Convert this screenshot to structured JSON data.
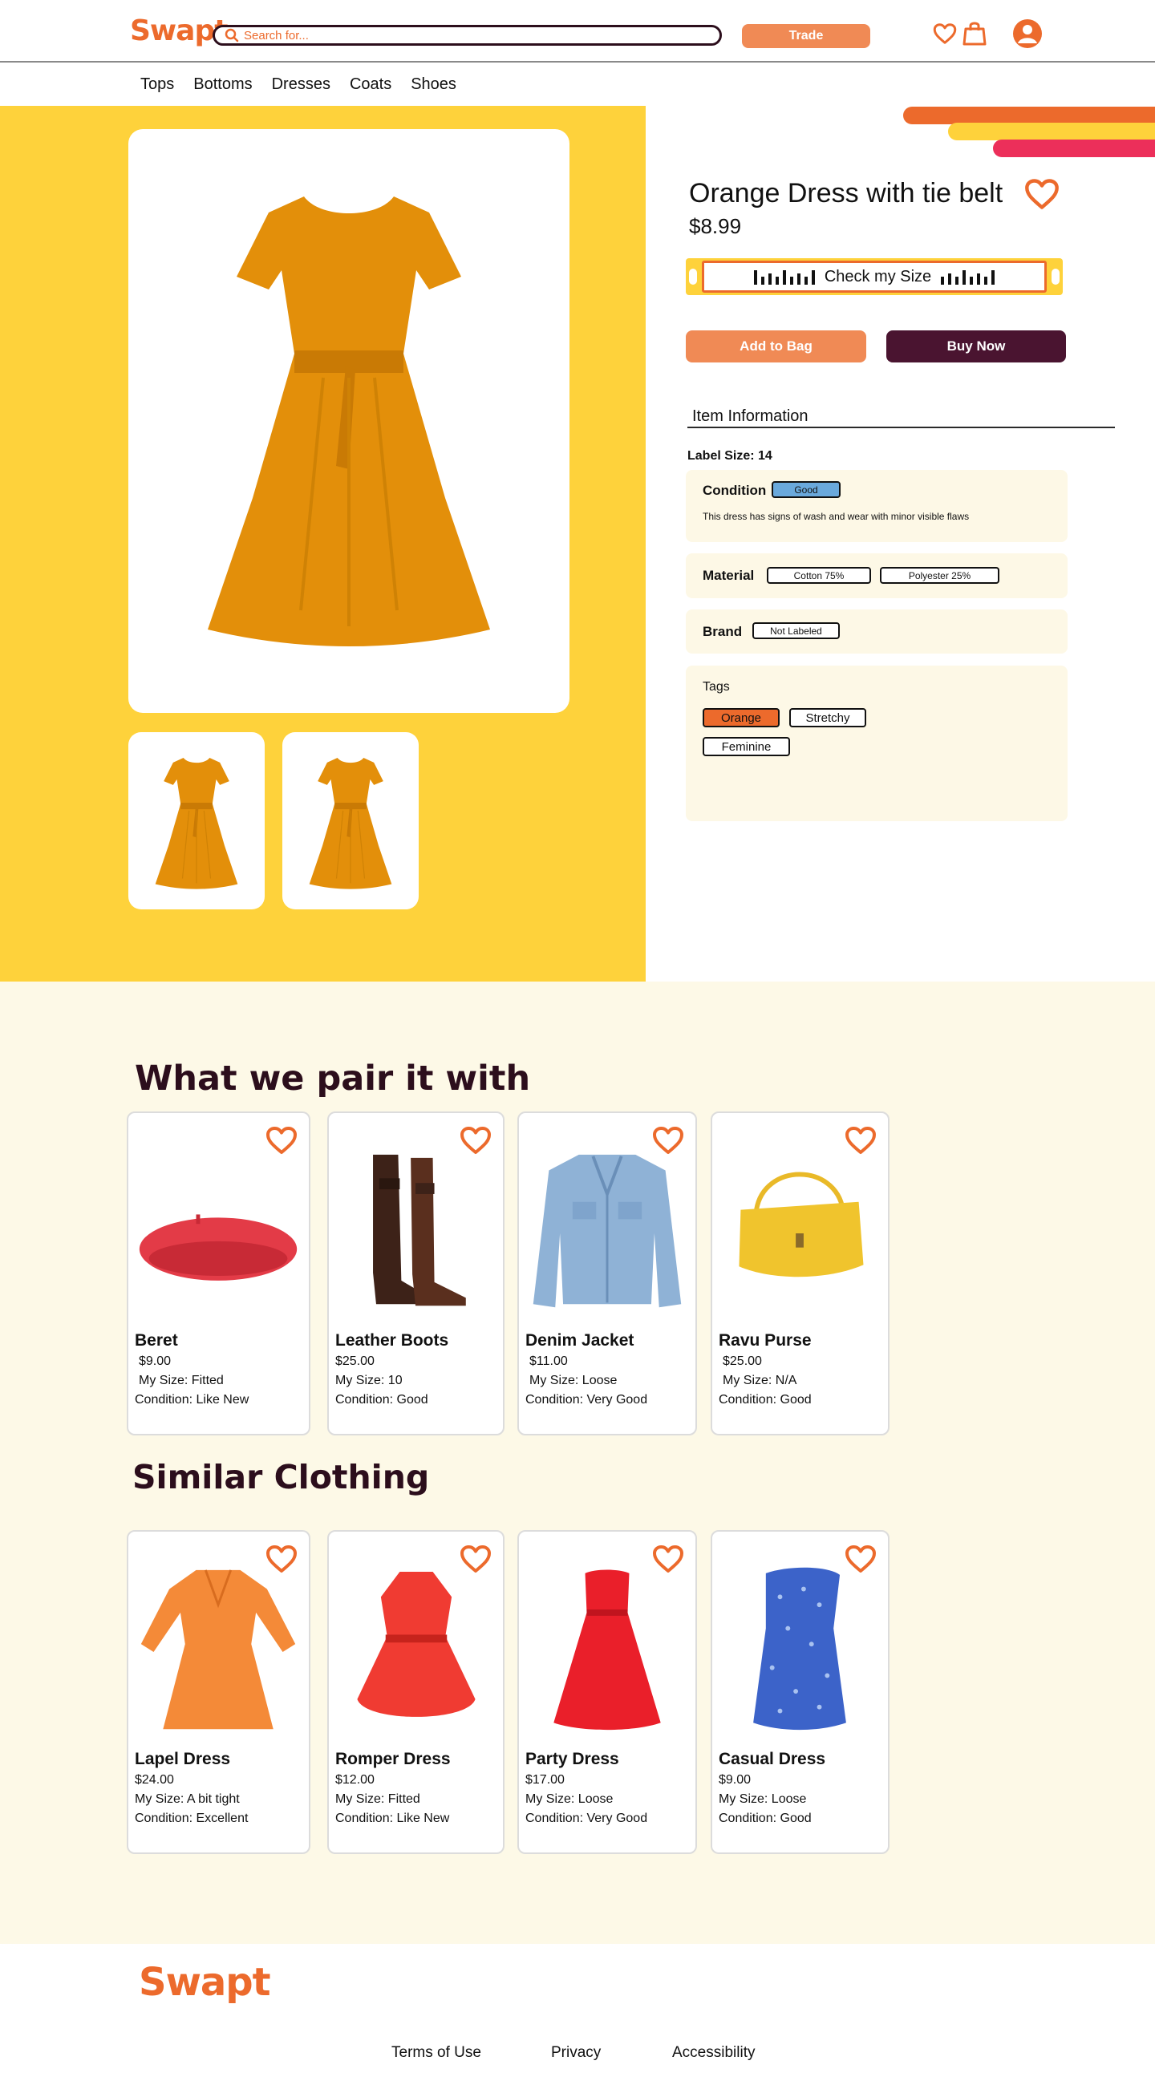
{
  "brand": {
    "logo": "Swapt",
    "accent": "#ec6a2c",
    "yellow": "#fed23b",
    "plum": "#4a1430"
  },
  "header": {
    "search_placeholder": "Search for...",
    "trade_label": "Trade",
    "icons": [
      "search-icon",
      "heart-icon",
      "bag-icon",
      "user-avatar-icon"
    ]
  },
  "nav": {
    "items": [
      "Tops",
      "Bottoms",
      "Dresses",
      "Coats",
      "Shoes"
    ]
  },
  "product": {
    "title": "Orange Dress with tie belt",
    "price": "$8.99",
    "check_size_label": "Check my Size",
    "add_to_bag_label": "Add to Bag",
    "buy_now_label": "Buy Now",
    "info_heading": "Item Information",
    "label_size": "Label Size: 14",
    "condition": {
      "key": "Condition",
      "value": "Good",
      "badge_color": "#6aa9dc",
      "description": "This dress has signs of wash and wear with minor visible flaws"
    },
    "material": {
      "key": "Material",
      "values": [
        "Cotton 75%",
        "Polyester 25%"
      ]
    },
    "brand_info": {
      "key": "Brand",
      "value": "Not  Labeled"
    },
    "tags": {
      "key": "Tags",
      "values": [
        "Orange",
        "Stretchy",
        "Feminine"
      ],
      "selected_color": "#ec6a2c"
    }
  },
  "pair_section": {
    "title": "What we pair it with",
    "items": [
      {
        "name": "Beret",
        "price": "$9.00",
        "size": "My Size: Fitted",
        "condition": "Condition: Like New"
      },
      {
        "name": "Leather Boots",
        "price": "$25.00",
        "size": "My Size: 10",
        "condition": "Condition: Good"
      },
      {
        "name": "Denim Jacket",
        "price": "$11.00",
        "size": "My Size: Loose",
        "condition": "Condition: Very Good"
      },
      {
        "name": "Ravu Purse",
        "price": "$25.00",
        "size": "My Size: N/A",
        "condition": "Condition: Good"
      }
    ]
  },
  "similar_section": {
    "title": "Similar Clothing",
    "items": [
      {
        "name": "Lapel Dress",
        "price": "$24.00",
        "size": "My Size: A bit tight",
        "condition": "Condition: Excellent"
      },
      {
        "name": "Romper Dress",
        "price": "$12.00",
        "size": "My Size: Fitted",
        "condition": "Condition: Like New"
      },
      {
        "name": "Party Dress",
        "price": "$17.00",
        "size": "My Size: Loose",
        "condition": "Condition: Very Good"
      },
      {
        "name": "Casual Dress",
        "price": "$9.00",
        "size": "My Size: Loose",
        "condition": "Condition: Good"
      }
    ]
  },
  "footer": {
    "logo": "Swapt",
    "links": [
      "Terms of Use",
      "Privacy",
      "Accessibility"
    ]
  }
}
